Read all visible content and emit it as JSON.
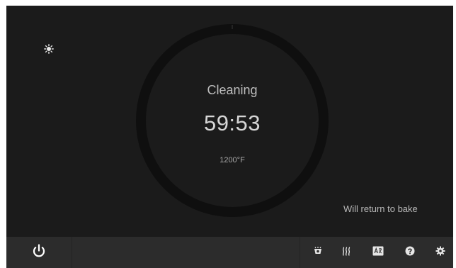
{
  "status": {
    "icon": "sun-lock-icon"
  },
  "dial": {
    "mode": "Cleaning",
    "time_remaining": "59:53",
    "temperature": "1200°F"
  },
  "message": "Will return to bake",
  "bottom_bar": {
    "power_icon": "power-icon",
    "right_icons": [
      "oven-light-icon",
      "steam-icon",
      "language-icon",
      "help-icon",
      "settings-icon"
    ]
  },
  "colors": {
    "background": "#1b1b1b",
    "ring": "#0e0e0e",
    "bar": "#2c2c2c"
  }
}
